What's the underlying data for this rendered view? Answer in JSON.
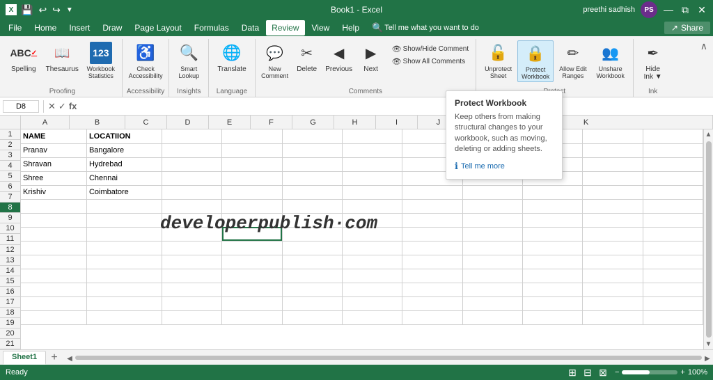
{
  "titleBar": {
    "title": "Book1 - Excel",
    "user": "preethi sadhish",
    "userInitials": "PS",
    "winButtons": [
      "—",
      "⧉",
      "✕"
    ]
  },
  "quickAccess": {
    "buttons": [
      "↩",
      "↪",
      "💾"
    ]
  },
  "menuBar": {
    "items": [
      "File",
      "Home",
      "Insert",
      "Draw",
      "Page Layout",
      "Formulas",
      "Data",
      "Review",
      "View",
      "Help"
    ],
    "activeItem": "Review",
    "tellMe": "Tell me what you want to do",
    "share": "Share"
  },
  "ribbon": {
    "groups": [
      {
        "id": "proofing",
        "label": "Proofing",
        "buttons": [
          {
            "id": "spelling",
            "label": "Spelling",
            "icon": "ABC"
          },
          {
            "id": "thesaurus",
            "label": "Thesaurus",
            "icon": "📖"
          },
          {
            "id": "workbook-statistics",
            "label": "Workbook Statistics",
            "icon": "123"
          }
        ]
      },
      {
        "id": "accessibility",
        "label": "Accessibility",
        "buttons": [
          {
            "id": "check-accessibility",
            "label": "Check Accessibility",
            "icon": "✓"
          }
        ]
      },
      {
        "id": "insights",
        "label": "Insights",
        "buttons": [
          {
            "id": "smart-lookup",
            "label": "Smart Lookup",
            "icon": "🔍"
          }
        ]
      },
      {
        "id": "language",
        "label": "Language",
        "buttons": [
          {
            "id": "translate",
            "label": "Translate",
            "icon": "A→"
          }
        ]
      },
      {
        "id": "comments",
        "label": "Comments",
        "buttons": [
          {
            "id": "new-comment",
            "label": "New Comment",
            "icon": "💬"
          },
          {
            "id": "delete",
            "label": "Delete",
            "icon": "🗑"
          },
          {
            "id": "previous",
            "label": "Previous",
            "icon": "◀"
          },
          {
            "id": "next",
            "label": "Next",
            "icon": "▶"
          },
          {
            "id": "show-hide-comment",
            "label": "Show/Hide Comment",
            "icon": "👁"
          },
          {
            "id": "show-all-comments",
            "label": "Show All Comments",
            "icon": "👁"
          }
        ]
      },
      {
        "id": "protect",
        "label": "Protect",
        "buttons": [
          {
            "id": "unprotect-sheet",
            "label": "Unprotect Sheet",
            "icon": "🔓"
          },
          {
            "id": "protect-workbook",
            "label": "Protect Workbook",
            "icon": "🔒",
            "active": true
          },
          {
            "id": "allow-edit-ranges",
            "label": "Allow Edit Ranges",
            "icon": "✏"
          },
          {
            "id": "unshare-workbook",
            "label": "Unshare Workbook",
            "icon": "👥"
          }
        ]
      },
      {
        "id": "ink",
        "label": "Ink",
        "buttons": [
          {
            "id": "hide-ink",
            "label": "Hide Ink",
            "icon": "✏"
          }
        ]
      }
    ]
  },
  "formulaBar": {
    "cellRef": "D8",
    "formula": ""
  },
  "spreadsheet": {
    "columns": [
      "A",
      "B",
      "C",
      "D",
      "E",
      "F",
      "G",
      "H",
      "I",
      "J",
      "K"
    ],
    "rows": [
      {
        "id": 1,
        "cells": [
          "NAME",
          "LOCATIION",
          "",
          "",
          "",
          "",
          "",
          "",
          "",
          "",
          ""
        ]
      },
      {
        "id": 2,
        "cells": [
          "Pranav",
          "Bangalore",
          "",
          "",
          "",
          "",
          "",
          "",
          "",
          "",
          ""
        ]
      },
      {
        "id": 3,
        "cells": [
          "Shravan",
          "Hydrebad",
          "",
          "",
          "",
          "",
          "",
          "",
          "",
          "",
          ""
        ]
      },
      {
        "id": 4,
        "cells": [
          "Shree",
          "Chennai",
          "",
          "",
          "",
          "",
          "",
          "",
          "",
          "",
          ""
        ]
      },
      {
        "id": 5,
        "cells": [
          "Krishiv",
          "Coimbatore",
          "",
          "",
          "",
          "",
          "",
          "",
          "",
          "",
          ""
        ]
      },
      {
        "id": 6,
        "cells": [
          "",
          "",
          "",
          "",
          "",
          "",
          "",
          "",
          "",
          "",
          ""
        ]
      },
      {
        "id": 7,
        "cells": [
          "",
          "",
          "",
          "",
          "",
          "",
          "",
          "",
          "",
          "",
          ""
        ]
      },
      {
        "id": 8,
        "cells": [
          "",
          "",
          "",
          "",
          "",
          "",
          "",
          "",
          "",
          "",
          ""
        ]
      },
      {
        "id": 9,
        "cells": [
          "",
          "",
          "",
          "",
          "",
          "",
          "",
          "",
          "",
          "",
          ""
        ]
      },
      {
        "id": 10,
        "cells": [
          "",
          "",
          "",
          "",
          "",
          "",
          "",
          "",
          "",
          "",
          ""
        ]
      },
      {
        "id": 11,
        "cells": [
          "",
          "",
          "",
          "",
          "",
          "",
          "",
          "",
          "",
          "",
          ""
        ]
      },
      {
        "id": 12,
        "cells": [
          "",
          "",
          "",
          "",
          "",
          "",
          "",
          "",
          "",
          "",
          ""
        ]
      },
      {
        "id": 13,
        "cells": [
          "",
          "",
          "",
          "",
          "",
          "",
          "",
          "",
          "",
          "",
          ""
        ]
      },
      {
        "id": 14,
        "cells": [
          "",
          "",
          "",
          "",
          "",
          "",
          "",
          "",
          "",
          "",
          ""
        ]
      },
      {
        "id": 15,
        "cells": [
          "",
          "",
          "",
          "",
          "",
          "",
          "",
          "",
          "",
          "",
          ""
        ]
      },
      {
        "id": 16,
        "cells": [
          "",
          "",
          "",
          "",
          "",
          "",
          "",
          "",
          "",
          "",
          ""
        ]
      },
      {
        "id": 17,
        "cells": [
          "",
          "",
          "",
          "",
          "",
          "",
          "",
          "",
          "",
          "",
          ""
        ]
      },
      {
        "id": 18,
        "cells": [
          "",
          "",
          "",
          "",
          "",
          "",
          "",
          "",
          "",
          "",
          ""
        ]
      },
      {
        "id": 19,
        "cells": [
          "",
          "",
          "",
          "",
          "",
          "",
          "",
          "",
          "",
          "",
          ""
        ]
      },
      {
        "id": 20,
        "cells": [
          "",
          "",
          "",
          "",
          "",
          "",
          "",
          "",
          "",
          "",
          ""
        ]
      },
      {
        "id": 21,
        "cells": [
          "",
          "",
          "",
          "",
          "",
          "",
          "",
          "",
          "",
          "",
          ""
        ]
      }
    ],
    "activeCell": {
      "row": 8,
      "col": 3
    },
    "watermark": "developerpublish·com"
  },
  "tooltip": {
    "title": "Protect Workbook",
    "description": "Keep others from making structural changes to your workbook, such as moving, deleting or adding sheets.",
    "linkText": "Tell me more"
  },
  "sheetTabs": {
    "sheets": [
      "Sheet1"
    ],
    "activeSheet": "Sheet1"
  },
  "statusBar": {
    "status": "Ready",
    "zoom": "100%"
  }
}
